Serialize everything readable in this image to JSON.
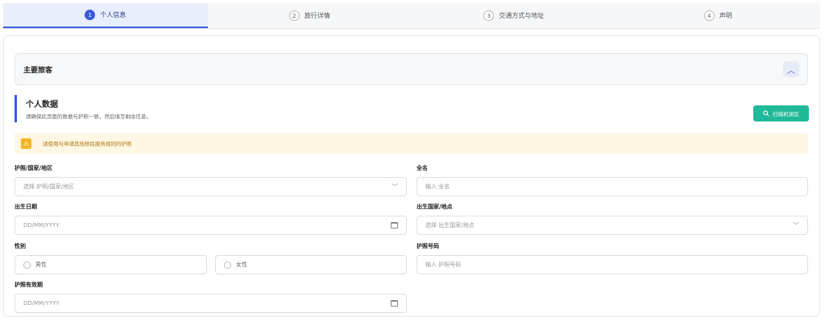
{
  "stepper": [
    {
      "num": "1",
      "label": "个人信息"
    },
    {
      "num": "2",
      "label": "旅行详情"
    },
    {
      "num": "3",
      "label": "交通方式与地址"
    },
    {
      "num": "4",
      "label": "声明"
    }
  ],
  "panel": {
    "title": "主要旅客",
    "collapse_glyph": "︿"
  },
  "section": {
    "title": "个人数据",
    "subtitle": "请确保此页面的数据与护照一致，然后填写剩余信息。",
    "scan_button": "扫描机读区"
  },
  "notice": {
    "text": "请使用与申请其他移民服务相同的护照",
    "icon": "warning-icon"
  },
  "fields": {
    "passport_country": {
      "label": "护照/国家/地区",
      "placeholder": "选择 护照/国家/地区"
    },
    "full_name": {
      "label": "全名",
      "placeholder": "输入 全名"
    },
    "birth_date": {
      "label": "出生日期",
      "placeholder": "DD/MM/YYYY"
    },
    "birth_country": {
      "label": "出生国家/地点",
      "placeholder": "选择 出生国家/地点"
    },
    "gender": {
      "label": "性别",
      "male": "男性",
      "female": "女性"
    },
    "passport_number": {
      "label": "护照号码",
      "placeholder": "输入 护照号码"
    },
    "passport_expiry": {
      "label": "护照有效期",
      "placeholder": "DD/MM/YYYY"
    }
  },
  "colors": {
    "accent": "#3b5bdb",
    "scan_button": "#20b99a",
    "notice_bg": "#fdf7e3",
    "notice_icon": "#f5b324"
  }
}
